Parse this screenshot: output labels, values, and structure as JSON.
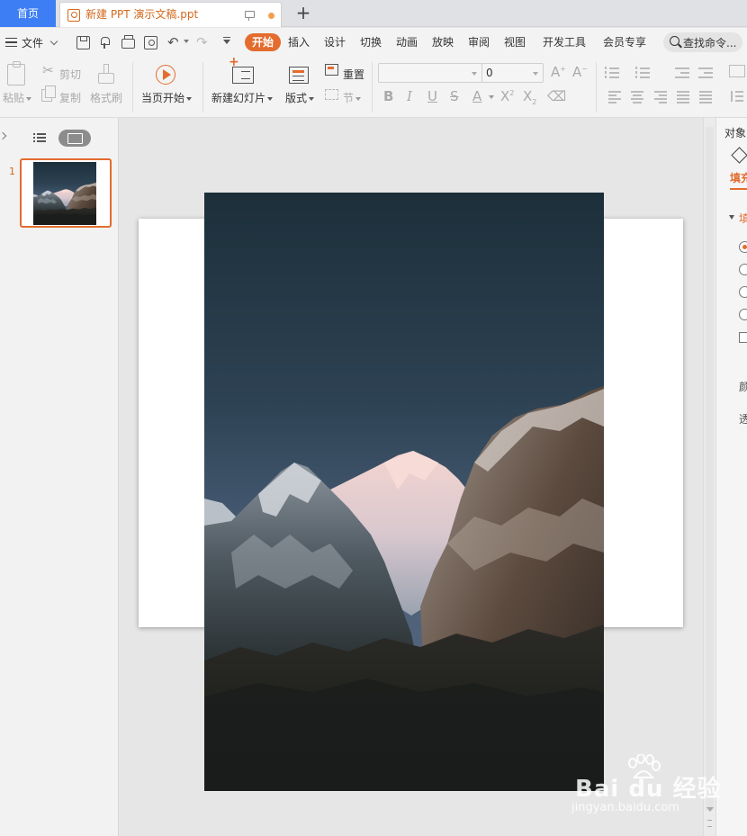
{
  "tabbar": {
    "home_label": "首页",
    "doc_title": "新建 PPT 演示文稿.ppt"
  },
  "menubar": {
    "file_label": "文件",
    "tabs": [
      "开始",
      "插入",
      "设计",
      "切换",
      "动画",
      "放映",
      "审阅",
      "视图",
      "开发工具",
      "会员专享"
    ],
    "active_tab": "开始",
    "search_placeholder": "查找命令..."
  },
  "ribbon": {
    "paste": "粘贴",
    "cut": "剪切",
    "copy": "复制",
    "format_painter": "格式刷",
    "start_from_current": "当页开始",
    "new_slide": "新建幻灯片",
    "layout": "版式",
    "reset": "重置",
    "section": "节",
    "font_name": "",
    "font_size": "0"
  },
  "left_panel": {
    "slide_number": "1"
  },
  "right_panel": {
    "title": "对象",
    "fill_tab": "填充",
    "fill_section": "填",
    "color_label": "颜",
    "transparency_label": "透"
  },
  "watermark": {
    "brand": "Bai du 经验",
    "url": "jingyan.baidu.com"
  },
  "colors": {
    "accent": "#e36c2e",
    "home_tab": "#3d7ef5",
    "sky_top": "#1f323d",
    "sky_bottom": "#4a5e78"
  }
}
